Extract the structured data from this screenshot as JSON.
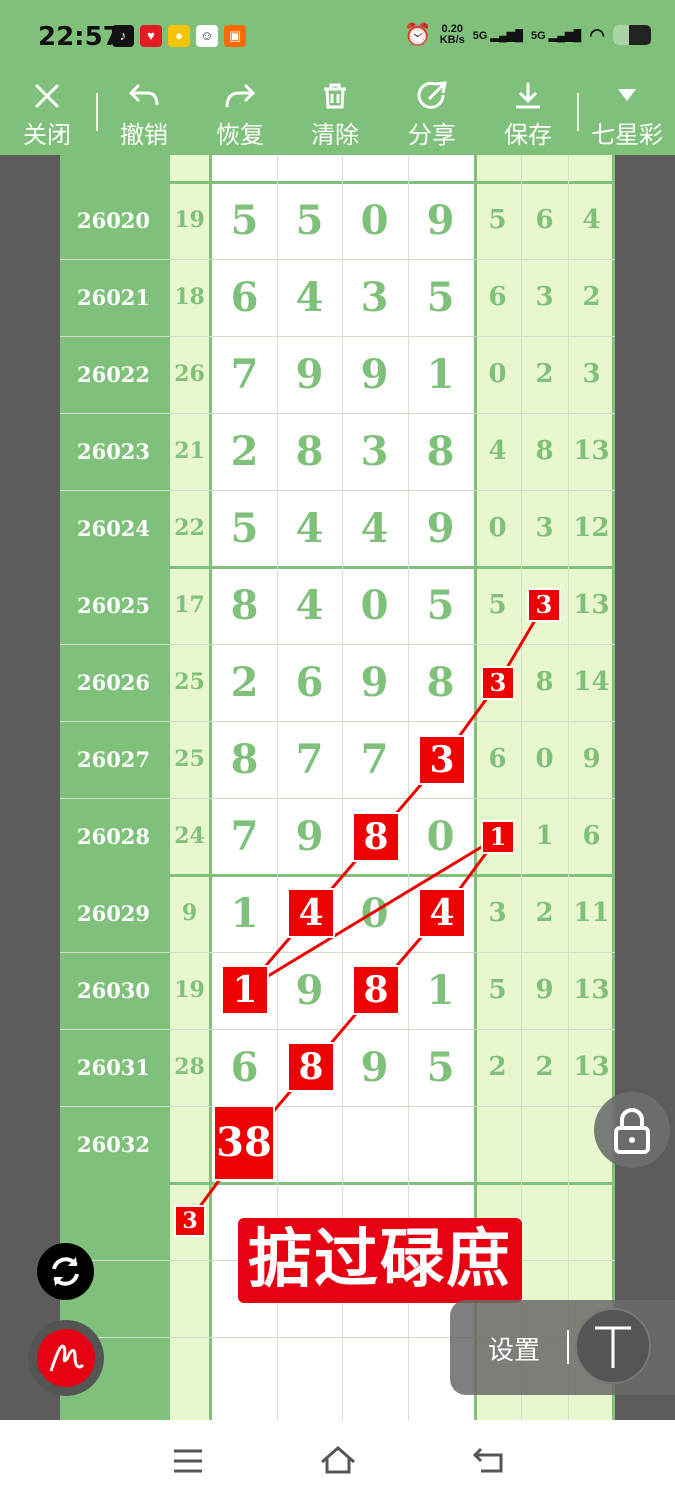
{
  "status_bar": {
    "time": "22:57",
    "net_speed_value": "0.20",
    "net_speed_unit": "KB/s",
    "signal_1": "5G",
    "signal_2": "5G"
  },
  "toolbar": {
    "close": "关闭",
    "undo": "撤销",
    "redo": "恢复",
    "clear": "清除",
    "share": "分享",
    "save": "保存",
    "mode": "七星彩"
  },
  "table": {
    "rows": [
      {
        "id": "26020",
        "sum": "19",
        "digits": [
          "5",
          "5",
          "0",
          "9"
        ],
        "side": [
          "5",
          "6",
          "4"
        ]
      },
      {
        "id": "26021",
        "sum": "18",
        "digits": [
          "6",
          "4",
          "3",
          "5"
        ],
        "side": [
          "6",
          "3",
          "2"
        ]
      },
      {
        "id": "26022",
        "sum": "26",
        "digits": [
          "7",
          "9",
          "9",
          "1"
        ],
        "side": [
          "0",
          "2",
          "3"
        ]
      },
      {
        "id": "26023",
        "sum": "21",
        "digits": [
          "2",
          "8",
          "3",
          "8"
        ],
        "side": [
          "4",
          "8",
          "13"
        ]
      },
      {
        "id": "26024",
        "sum": "22",
        "digits": [
          "5",
          "4",
          "4",
          "9"
        ],
        "side": [
          "0",
          "3",
          "12"
        ]
      },
      {
        "id": "26025",
        "sum": "17",
        "digits": [
          "8",
          "4",
          "0",
          "5"
        ],
        "side": [
          "5",
          "3",
          "13"
        ]
      },
      {
        "id": "26026",
        "sum": "25",
        "digits": [
          "2",
          "6",
          "9",
          "8"
        ],
        "side": [
          "3",
          "8",
          "14"
        ]
      },
      {
        "id": "26027",
        "sum": "25",
        "digits": [
          "8",
          "7",
          "7",
          "3"
        ],
        "side": [
          "6",
          "0",
          "9"
        ]
      },
      {
        "id": "26028",
        "sum": "24",
        "digits": [
          "7",
          "9",
          "8",
          "0"
        ],
        "side": [
          "1",
          "1",
          "6"
        ]
      },
      {
        "id": "26029",
        "sum": "9",
        "digits": [
          "1",
          "4",
          "0",
          "4"
        ],
        "side": [
          "3",
          "2",
          "11"
        ]
      },
      {
        "id": "26030",
        "sum": "19",
        "digits": [
          "1",
          "9",
          "8",
          "1"
        ],
        "side": [
          "5",
          "9",
          "13"
        ]
      },
      {
        "id": "26031",
        "sum": "28",
        "digits": [
          "6",
          "8",
          "9",
          "5"
        ],
        "side": [
          "2",
          "2",
          "13"
        ]
      },
      {
        "id": "26032",
        "sum": "",
        "digits": [
          "38",
          "",
          "",
          ""
        ],
        "side": [
          "",
          "",
          ""
        ]
      }
    ]
  },
  "annotations": {
    "extra_mark": "3",
    "banner_text": "掂过碌庶"
  },
  "settings_panel": {
    "label": "设置"
  },
  "colors": {
    "green": "#7fc17a",
    "light_green": "#e9f7cf",
    "mark_red": "#e00000"
  }
}
